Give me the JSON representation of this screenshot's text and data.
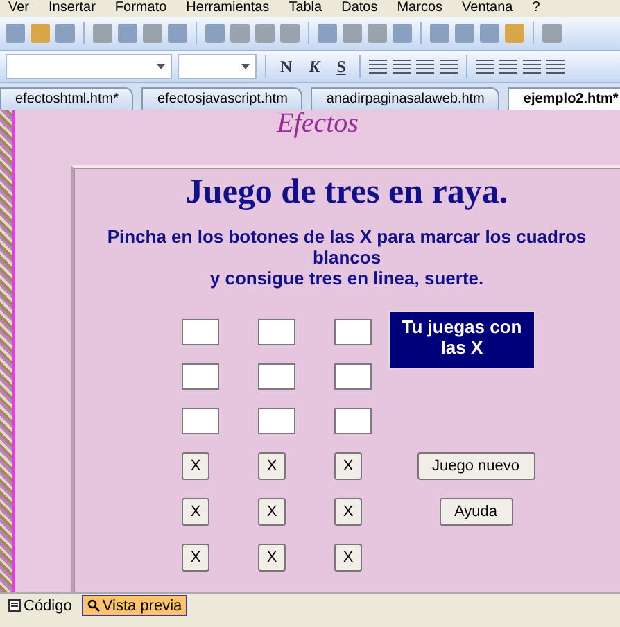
{
  "menu": [
    "Ver",
    "Insertar",
    "Formato",
    "Herramientas",
    "Tabla",
    "Datos",
    "Marcos",
    "Ventana",
    "?"
  ],
  "format_buttons": [
    "N",
    "K",
    "S"
  ],
  "tabs": [
    {
      "label": "efectoshtml.htm*",
      "selected": false
    },
    {
      "label": "efectosjavascript.htm",
      "selected": false
    },
    {
      "label": "anadirpaginasalaweb.htm",
      "selected": false
    },
    {
      "label": "ejemplo2.htm*",
      "selected": true
    }
  ],
  "page": {
    "banner": "Efectos",
    "title": "Juego de tres en raya.",
    "instructions": "Pincha en los botones de las X para marcar los cuadros blancos",
    "instructions_2": "y consigue tres en linea, suerte.",
    "player_box": "Tu juegas con las X",
    "board": [
      [
        {
          "filled": false
        },
        {
          "filled": false
        },
        {
          "filled": false
        }
      ],
      [
        {
          "filled": false
        },
        {
          "filled": false
        },
        {
          "filled": false
        }
      ],
      [
        {
          "filled": false
        },
        {
          "filled": false
        },
        {
          "filled": false
        }
      ]
    ],
    "x_buttons": [
      [
        "X",
        "X",
        "X"
      ],
      [
        "X",
        "X",
        "X"
      ],
      [
        "X",
        "X",
        "X"
      ]
    ],
    "side_buttons": [
      "Juego nuevo",
      "Ayuda"
    ]
  },
  "view_tabs": [
    {
      "label": "Código",
      "selected": false
    },
    {
      "label": "Vista previa",
      "selected": true
    }
  ]
}
